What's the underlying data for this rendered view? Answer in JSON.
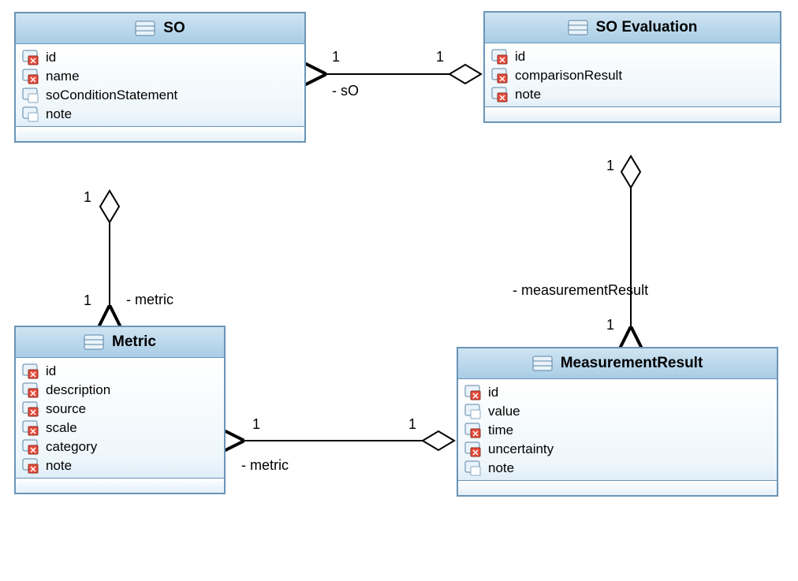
{
  "classes": {
    "so": {
      "title": "SO",
      "attrs": [
        "id",
        "name",
        "soConditionStatement",
        "note"
      ],
      "attrIcon": [
        "r",
        "r",
        "w",
        "w"
      ]
    },
    "soEval": {
      "title": "SO Evaluation",
      "attrs": [
        "id",
        "comparisonResult",
        "note"
      ],
      "attrIcon": [
        "r",
        "r",
        "r"
      ]
    },
    "metric": {
      "title": "Metric",
      "attrs": [
        "id",
        "description",
        "source",
        "scale",
        "category",
        "note"
      ],
      "attrIcon": [
        "r",
        "r",
        "r",
        "r",
        "r",
        "r"
      ]
    },
    "measRes": {
      "title": "MeasurementResult",
      "attrs": [
        "id",
        "value",
        "time",
        "uncertainty",
        "note"
      ],
      "attrIcon": [
        "r",
        "w",
        "r",
        "r",
        "w"
      ]
    }
  },
  "labels": {
    "one": "1",
    "role_sO": "- sO",
    "role_metric": "- metric",
    "role_measRes": "- measurementResult"
  }
}
